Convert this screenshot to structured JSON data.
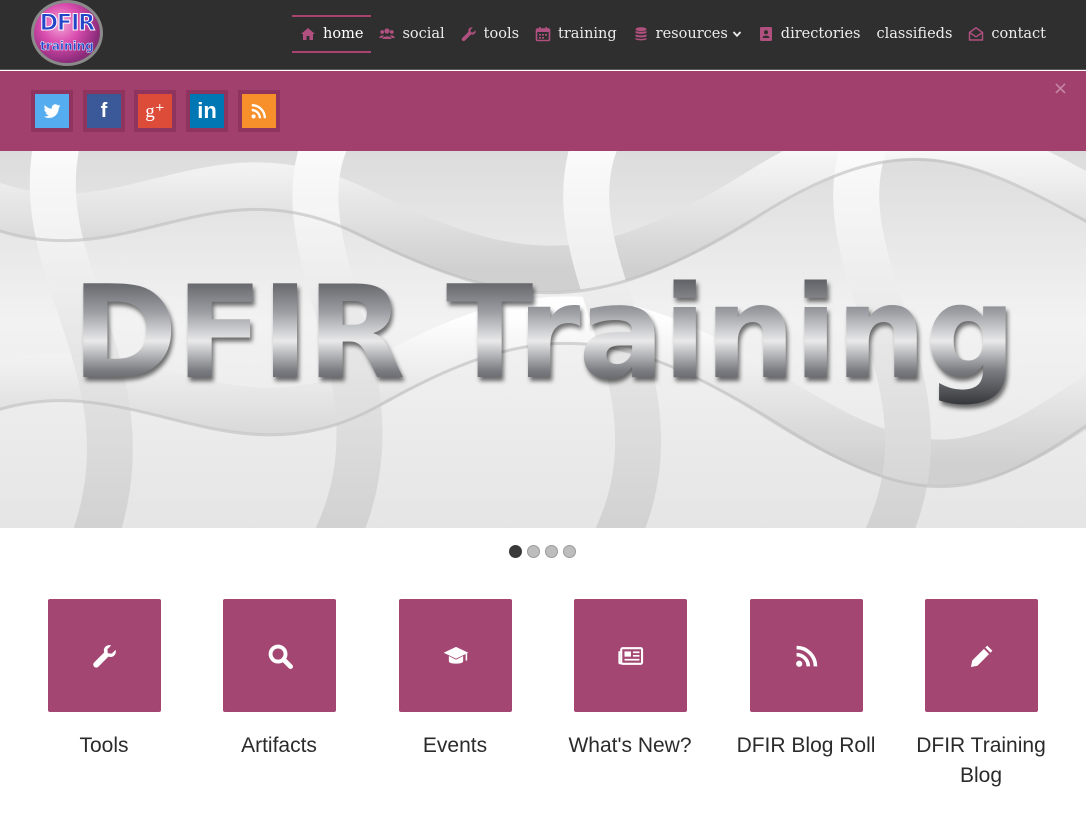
{
  "logo": {
    "line1": "DFIR",
    "line2": "training"
  },
  "nav": {
    "items": [
      {
        "label": "home",
        "icon": "home-icon",
        "active": true
      },
      {
        "label": "social",
        "icon": "users-icon"
      },
      {
        "label": "tools",
        "icon": "wrench-icon"
      },
      {
        "label": "training",
        "icon": "calendar-icon"
      },
      {
        "label": "resources",
        "icon": "database-icon",
        "dropdown": true
      },
      {
        "label": "directories",
        "icon": "address-book-icon"
      },
      {
        "label": "classifieds",
        "icon": ""
      },
      {
        "label": "contact",
        "icon": "envelope-open-icon"
      }
    ]
  },
  "social": {
    "buttons": [
      {
        "name": "twitter",
        "icon": "twitter-icon",
        "color": "#55acee"
      },
      {
        "name": "facebook",
        "icon": "facebook-icon",
        "color": "#3b5998",
        "glyph": "f"
      },
      {
        "name": "google-plus",
        "icon": "google-plus-icon",
        "color": "#dd4b39",
        "glyph": "g⁺"
      },
      {
        "name": "linkedin",
        "icon": "linkedin-icon",
        "color": "#0077b5",
        "glyph": "in"
      },
      {
        "name": "rss",
        "icon": "rss-icon",
        "color": "#f7902b"
      }
    ],
    "close": "×"
  },
  "hero": {
    "title": "DFIR Training"
  },
  "carousel": {
    "slides": 4,
    "active": 1
  },
  "tiles": [
    {
      "label": "Tools",
      "icon": "wrench-icon"
    },
    {
      "label": "Artifacts",
      "icon": "search-icon"
    },
    {
      "label": "Events",
      "icon": "graduation-cap-icon"
    },
    {
      "label": "What's New?",
      "icon": "newspaper-icon"
    },
    {
      "label": "DFIR Blog Roll",
      "icon": "rss-icon"
    },
    {
      "label": "DFIR Training Blog",
      "icon": "pencil-icon"
    }
  ],
  "colors": {
    "brand": "#a13f6d",
    "tile": "#a34672",
    "navbar": "#2f2f2f"
  }
}
